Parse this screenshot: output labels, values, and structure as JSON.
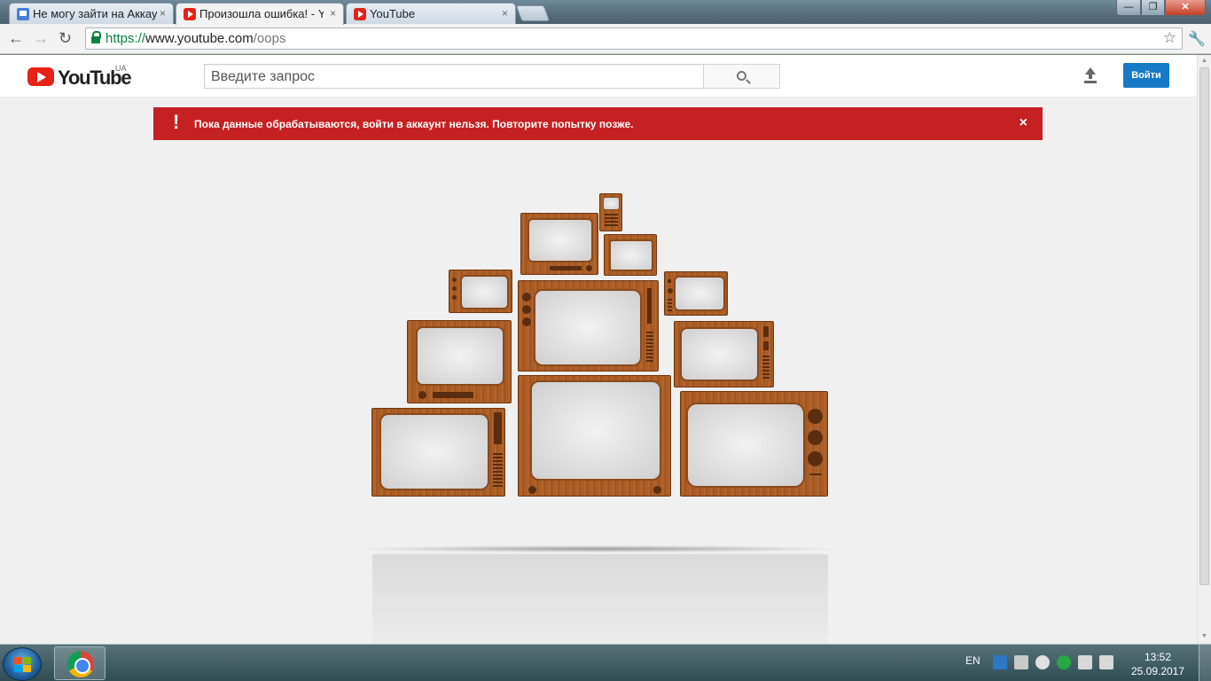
{
  "browser": {
    "tabs": [
      {
        "label": "Не могу зайти на Аккаун",
        "icon": "help-forum-icon"
      },
      {
        "label": "Произошла ошибка! - You",
        "icon": "youtube-icon",
        "active": true
      },
      {
        "label": "YouTube",
        "icon": "youtube-icon"
      }
    ],
    "tab_close": "×",
    "address": {
      "scheme": "https://",
      "host": "www.youtube.com",
      "path": "/oops"
    },
    "nav": {
      "back": "←",
      "forward": "→",
      "reload": "↻",
      "star": "☆",
      "wrench": "🔧"
    }
  },
  "youtube": {
    "logo_text": "YouTube",
    "country_code": "UA",
    "search_placeholder": "Введите запрос",
    "signin_label": "Войти"
  },
  "alert": {
    "icon": "!",
    "message": "Пока данные обрабатываются, войти в аккаунт нельзя. Повторите попытку позже.",
    "close": "×",
    "color": "#c62122"
  },
  "taskbar": {
    "language": "EN",
    "time": "13:52",
    "date": "25.09.2017"
  },
  "colors": {
    "accent": "#167ac6",
    "youtube_red": "#e62117"
  }
}
